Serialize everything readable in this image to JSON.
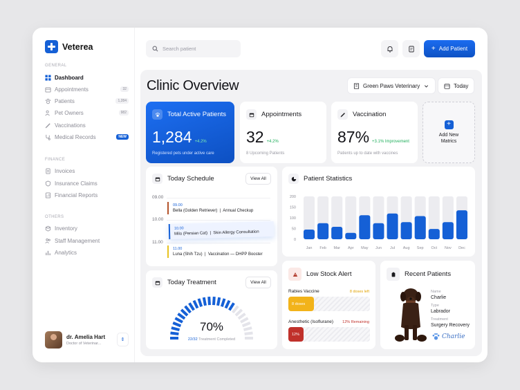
{
  "brand": {
    "name": "Veterea"
  },
  "sidebar": {
    "sections": [
      {
        "label": "General"
      },
      {
        "label": "Finance"
      },
      {
        "label": "Others"
      }
    ],
    "items": [
      {
        "label": "Dashboard",
        "icon": "grid-icon"
      },
      {
        "label": "Appointments",
        "badge": "32",
        "icon": "calendar-icon"
      },
      {
        "label": "Patients",
        "badge": "1,284",
        "icon": "paw-icon"
      },
      {
        "label": "Pet Owners",
        "badge": "982",
        "icon": "users-icon"
      },
      {
        "label": "Vaccinations",
        "icon": "syringe-icon"
      },
      {
        "label": "Medical Records",
        "badge": "NEW",
        "icon": "stethoscope-icon"
      },
      {
        "label": "Invoices",
        "icon": "receipt-icon"
      },
      {
        "label": "Insurance Claims",
        "icon": "shield-icon"
      },
      {
        "label": "Financial Reports",
        "icon": "report-icon"
      },
      {
        "label": "Inventory",
        "icon": "box-icon"
      },
      {
        "label": "Staff Management",
        "icon": "staff-icon"
      },
      {
        "label": "Analytics",
        "icon": "analytics-icon"
      }
    ],
    "user": {
      "name": "dr. Amelia Hart",
      "role": "Doctor of Veterinar..."
    }
  },
  "topbar": {
    "search_placeholder": "Search patient",
    "add_label": "Add Patient"
  },
  "page": {
    "title": "Clinic Overview",
    "clinic": "Green Paws Veterinary",
    "date": "Today"
  },
  "stats": [
    {
      "title": "Total Active Patients",
      "value": "1,284",
      "change": "+4.2%",
      "sub": "Registered pets under active care"
    },
    {
      "title": "Appointments",
      "value": "32",
      "change": "+4.2%",
      "sub": "8 Upcoming Patients"
    },
    {
      "title": "Vaccination",
      "value": "87%",
      "change": "+3.1% Improvement",
      "sub": "Patients up to date with vaccines"
    }
  ],
  "add_metrics": {
    "label": "Add New Matrics"
  },
  "schedule": {
    "title": "Today Schedule",
    "view_all": "View All",
    "hours": [
      "09.00",
      "10.00",
      "11.00"
    ],
    "items": [
      {
        "time": "09.00",
        "pet": "Bella (Golden Retriever)",
        "task": "Annual Checkup",
        "color": "#b4532a"
      },
      {
        "time": "10.00",
        "pet": "Milo (Persian Cat)",
        "task": "Skin Allergy Consultation",
        "color": "#1560d6"
      },
      {
        "time": "11.00",
        "pet": "Luna (Shih Tzu)",
        "task": "Vaccination — DHPP Booster",
        "color": "#e7c21f"
      }
    ]
  },
  "treatment": {
    "title": "Today Treatment",
    "view_all": "View All",
    "percent_label": "70%",
    "percent": 0.7,
    "done": "22/32",
    "caption": "Treatment Completed"
  },
  "chart_data": {
    "type": "bar",
    "title": "Patient Statistics",
    "categories": [
      "Jan",
      "Feb",
      "Mar",
      "Apr",
      "May",
      "Jun",
      "Jul",
      "Aug",
      "Sep",
      "Oct",
      "Nov",
      "Dec"
    ],
    "values": [
      45,
      75,
      58,
      30,
      112,
      75,
      120,
      80,
      108,
      48,
      80,
      135
    ],
    "yticks": [
      200,
      150,
      100,
      50,
      0
    ],
    "ylim": [
      0,
      200
    ],
    "grid": false,
    "bar_color": "#1560d6"
  },
  "low_stock": {
    "title": "Low Stock Alert",
    "items": [
      {
        "name": "Rabies Vaccine",
        "status": "8 doses left",
        "bar_label": "8 doses",
        "level": 0.31,
        "color": "#f2b31a",
        "status_color": "#e0a200"
      },
      {
        "name": "Anesthetic (Isoflurane)",
        "status": "12% Remaining",
        "bar_label": "12%",
        "level": 0.19,
        "color": "#c0312b",
        "status_color": "#c0312b"
      }
    ]
  },
  "recent": {
    "title": "Recent Patients",
    "fields": [
      {
        "label": "Name",
        "value": "Charlie"
      },
      {
        "label": "Type",
        "value": "Labrador"
      },
      {
        "label": "Treatment",
        "value": "Surgery Recovery"
      }
    ],
    "signature": "Charlie"
  }
}
